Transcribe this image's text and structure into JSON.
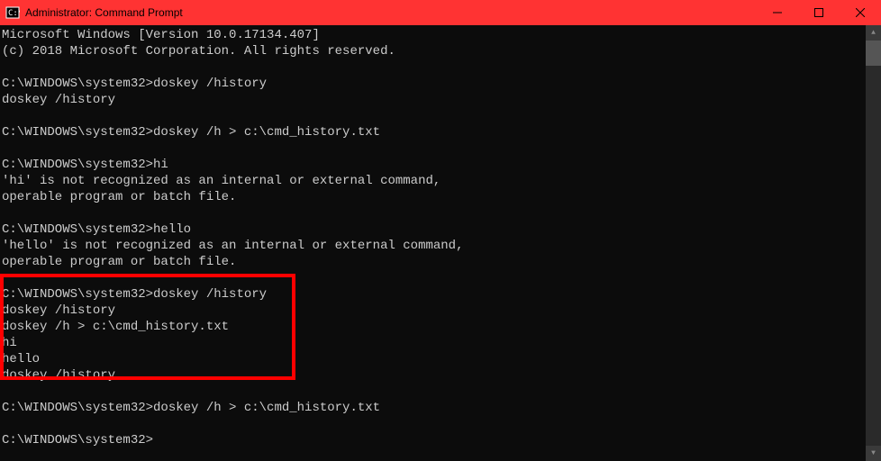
{
  "titlebar": {
    "title": "Administrator: Command Prompt"
  },
  "terminal": {
    "lines": [
      "Microsoft Windows [Version 10.0.17134.407]",
      "(c) 2018 Microsoft Corporation. All rights reserved.",
      "",
      "C:\\WINDOWS\\system32>doskey /history",
      "doskey /history",
      "",
      "C:\\WINDOWS\\system32>doskey /h > c:\\cmd_history.txt",
      "",
      "C:\\WINDOWS\\system32>hi",
      "'hi' is not recognized as an internal or external command,",
      "operable program or batch file.",
      "",
      "C:\\WINDOWS\\system32>hello",
      "'hello' is not recognized as an internal or external command,",
      "operable program or batch file.",
      "",
      "C:\\WINDOWS\\system32>doskey /history",
      "doskey /history",
      "doskey /h > c:\\cmd_history.txt",
      "hi",
      "hello",
      "doskey /history",
      "",
      "C:\\WINDOWS\\system32>doskey /h > c:\\cmd_history.txt",
      "",
      "C:\\WINDOWS\\system32>"
    ]
  }
}
